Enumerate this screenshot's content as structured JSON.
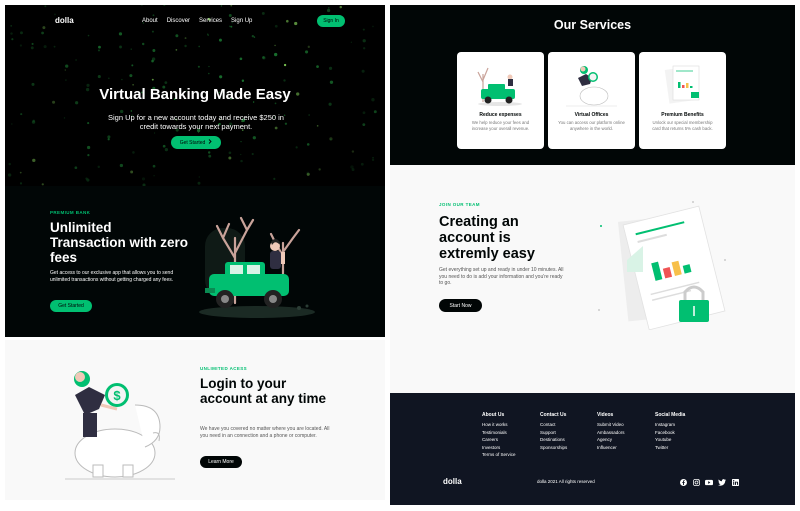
{
  "nav": {
    "logo": "dolla",
    "links": [
      "About",
      "Discover",
      "Services",
      "Sign Up"
    ],
    "signin": "Sign In"
  },
  "hero": {
    "title": "Virtual Banking Made Easy",
    "description": "Sign Up for a new account today and receive $250 in credit towards your next payment.",
    "button": "Get Started",
    "button_icon": "chevron-right-icon"
  },
  "about": {
    "topline": "PREMIUM BANK",
    "headline": "Unlimited Transaction with zero fees",
    "description": "Get access to our exclusive app that allows you to send unlimited transactions without getting charged any fees.",
    "button": "Get Started"
  },
  "discover": {
    "topline": "UNLIMITED ACESS",
    "headline": "Login to your account at any time",
    "description": "We have you covered no matter where you are located. All you need in an connection and a phone or computer.",
    "button": "Learn More"
  },
  "services": {
    "title": "Our Services",
    "cards": [
      {
        "title": "Reduce expenses",
        "desc": "We help reduce your fees and increase your overall revenue."
      },
      {
        "title": "Virtual Offices",
        "desc": "You can access our platform online anywhere in the world."
      },
      {
        "title": "Premium Benefits",
        "desc": "Unlock our special membership card that returns 5% cash back."
      }
    ]
  },
  "join": {
    "topline": "JOIN OUR TEAM",
    "headline": "Creating an account is extremly easy",
    "description": "Get everything set up and ready in under 10 minutes. All you need to do is add your information and you're ready to go.",
    "button": "Start Now"
  },
  "footer": {
    "columns": [
      {
        "title": "About Us",
        "links": [
          "How it works",
          "Testimonials",
          "Careers",
          "Investors",
          "Terms of Service"
        ]
      },
      {
        "title": "Contact Us",
        "links": [
          "Contact",
          "Support",
          "Destinations",
          "Sponsorships"
        ]
      },
      {
        "title": "Videos",
        "links": [
          "Submit Video",
          "Ambassadors",
          "Agency",
          "Influencer"
        ]
      },
      {
        "title": "Social Media",
        "links": [
          "Instagram",
          "Facebook",
          "Youtube",
          "Twitter"
        ]
      }
    ],
    "logo": "dolla",
    "copyright": "dolla 2021 All rights reserved",
    "social_icons": [
      "facebook-icon",
      "instagram-icon",
      "youtube-icon",
      "twitter-icon",
      "linkedin-icon"
    ]
  },
  "colors": {
    "accent": "#01bf71",
    "dark": "#010606",
    "footer": "#101522",
    "light": "#f9f9f9"
  }
}
